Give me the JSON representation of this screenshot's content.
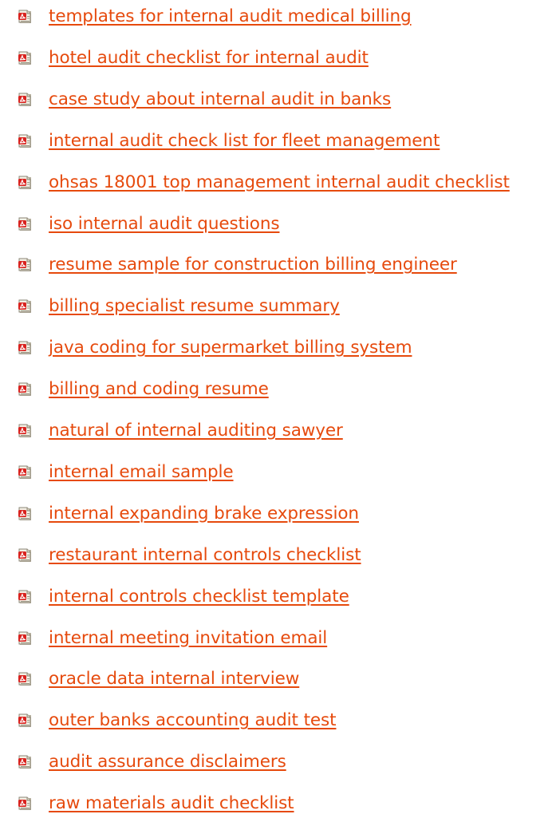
{
  "links": [
    {
      "label": "templates for internal audit medical billing",
      "icon": "pdf-file-icon"
    },
    {
      "label": "hotel audit checklist for internal audit",
      "icon": "pdf-file-icon"
    },
    {
      "label": "case study about internal audit in banks",
      "icon": "pdf-file-icon"
    },
    {
      "label": "internal audit check list for fleet management",
      "icon": "pdf-file-icon"
    },
    {
      "label": "ohsas 18001 top management internal audit checklist",
      "icon": "pdf-file-icon"
    },
    {
      "label": "iso internal audit questions",
      "icon": "pdf-file-icon"
    },
    {
      "label": "resume sample for construction billing engineer",
      "icon": "pdf-file-icon"
    },
    {
      "label": "billing specialist resume summary",
      "icon": "pdf-file-icon"
    },
    {
      "label": "java coding for supermarket billing system",
      "icon": "pdf-file-icon"
    },
    {
      "label": "billing and coding resume",
      "icon": "pdf-file-icon"
    },
    {
      "label": "natural of internal auditing sawyer",
      "icon": "pdf-file-icon"
    },
    {
      "label": "internal email sample",
      "icon": "pdf-file-icon"
    },
    {
      "label": "internal expanding brake expression",
      "icon": "pdf-file-icon"
    },
    {
      "label": "restaurant internal controls checklist",
      "icon": "pdf-file-icon"
    },
    {
      "label": "internal controls checklist template",
      "icon": "pdf-file-icon"
    },
    {
      "label": "internal meeting invitation email",
      "icon": "pdf-file-icon"
    },
    {
      "label": "oracle data internal interview",
      "icon": "pdf-file-icon"
    },
    {
      "label": "outer banks accounting audit test",
      "icon": "pdf-file-icon"
    },
    {
      "label": "audit assurance disclaimers",
      "icon": "pdf-file-icon"
    },
    {
      "label": "raw materials audit checklist",
      "icon": "pdf-file-icon"
    }
  ],
  "colors": {
    "link": "#e64a0d",
    "icon_red": "#d9231f",
    "icon_paper": "#f4f1e6"
  }
}
